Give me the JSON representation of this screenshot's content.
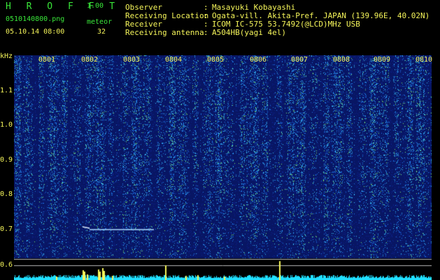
{
  "header": {
    "app_title": "H R O F F T",
    "version": "1.00",
    "filename": "0510140800.png",
    "meteor_label": "meteor",
    "datetime": "05.10.14 08:00",
    "meteor_count": "32"
  },
  "info": {
    "rows": [
      {
        "label": "Observer",
        "value": "Masayuki Kobayashi"
      },
      {
        "label": "Receiving Location",
        "value": "Ogata-vill. Akita-Pref. JAPAN (139.96E, 40.02N)"
      },
      {
        "label": "Receiver",
        "value": "ICOM IC-575 53.7492(@LCD)MHz USB"
      },
      {
        "label": "Receiving antenna",
        "value": "A504HB(yagi 4el)"
      }
    ],
    "colon": ":"
  },
  "axis": {
    "unit": "kHz",
    "y_ticks": [
      "1.1",
      "1.0",
      "0.9",
      "0.8",
      "0.7",
      "0.6"
    ],
    "x_ticks": [
      "0801",
      "0802",
      "0803",
      "0804",
      "0805",
      "0806",
      "0807",
      "0808",
      "0809",
      "0810"
    ]
  },
  "colors": {
    "background": "#000000",
    "text": "#f5f55a",
    "title": "#39e639",
    "spectrogram_base": "#0a1a6e",
    "spectrogram_noise": "#3a8cff",
    "baseline_bar": "#20e0ff",
    "meteor_count_bar": "#f5f55a"
  }
}
